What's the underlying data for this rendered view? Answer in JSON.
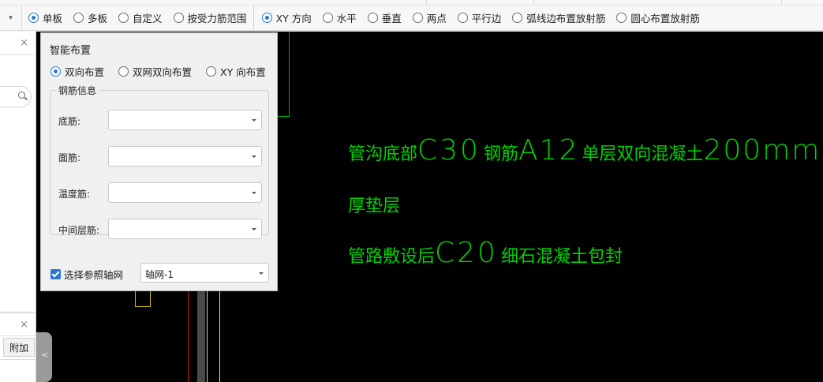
{
  "toolbar": {
    "mode_options": [
      {
        "label": "单板",
        "checked": true
      },
      {
        "label": "多板",
        "checked": false
      },
      {
        "label": "自定义",
        "checked": false
      },
      {
        "label": "按受力筋范围",
        "checked": false
      }
    ],
    "direction_options": [
      {
        "label": "XY 方向",
        "checked": true
      },
      {
        "label": "水平",
        "checked": false
      },
      {
        "label": "垂直",
        "checked": false
      },
      {
        "label": "两点",
        "checked": false
      },
      {
        "label": "平行边",
        "checked": false
      },
      {
        "label": "弧线边布置放射筋",
        "checked": false
      },
      {
        "label": "圆心布置放射筋",
        "checked": false
      }
    ]
  },
  "left_panel": {
    "close_glyph": "×"
  },
  "left_panel2": {
    "close_glyph": "×",
    "button_label": "附加"
  },
  "side_tab": {
    "glyph": "<"
  },
  "dialog": {
    "title": "智能布置",
    "layout_options": [
      {
        "label": "双向布置",
        "checked": true
      },
      {
        "label": "双网双向布置",
        "checked": false
      },
      {
        "label": "XY 向布置",
        "checked": false
      }
    ],
    "group_title": "钢筋信息",
    "fields": [
      {
        "label": "底筋:",
        "value": ""
      },
      {
        "label": "面筋:",
        "value": ""
      },
      {
        "label": "温度筋:",
        "value": ""
      },
      {
        "label": "中间层筋:",
        "value": ""
      }
    ],
    "ref_axis_checkbox_label": "选择参照轴网",
    "ref_axis_checked": true,
    "axis_grid_value": "轴网-1"
  },
  "canvas_text": {
    "line1_prefix": "管沟底部",
    "line1_big1": "C30",
    "line1_mid": "钢筋",
    "line1_big2": "A12",
    "line1_mid2": "单层双向混凝土",
    "line1_big3": "200mm",
    "line2": "厚垫层",
    "line3_prefix": "管路敷设后",
    "line3_big": "C20",
    "line3_suffix": "细石混凝土包封"
  },
  "colors": {
    "cad_green": "#00d400",
    "canvas_bg": "#000000",
    "accent_blue": "#2b78d4"
  }
}
